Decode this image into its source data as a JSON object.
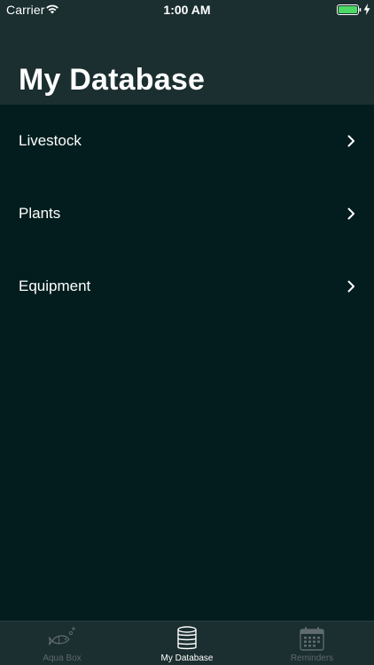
{
  "status_bar": {
    "carrier": "Carrier",
    "time": "1:00 AM",
    "battery_color": "#4cd964"
  },
  "header": {
    "title": "My Database"
  },
  "list": {
    "items": [
      {
        "label": "Livestock"
      },
      {
        "label": "Plants"
      },
      {
        "label": "Equipment"
      }
    ]
  },
  "tab_bar": {
    "tabs": [
      {
        "label": "Aqua Box",
        "icon": "fish-icon",
        "active": false
      },
      {
        "label": "My Database",
        "icon": "database-icon",
        "active": true
      },
      {
        "label": "Reminders",
        "icon": "calendar-icon",
        "active": false
      }
    ]
  },
  "colors": {
    "background": "#031d1e",
    "bar_background": "#1b2e30",
    "active_tab": "#ffffff",
    "inactive_tab": "#5f6b6c"
  }
}
